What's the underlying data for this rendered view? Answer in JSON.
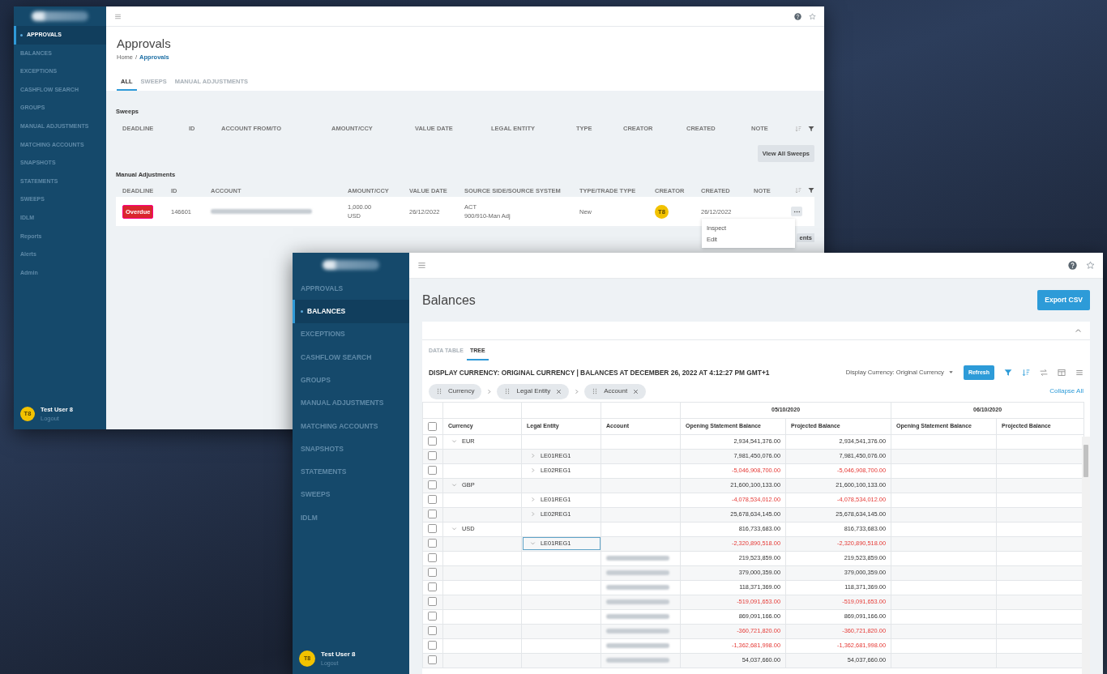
{
  "approvals_window": {
    "sidebar": {
      "items": [
        {
          "label": "APPROVALS",
          "selected": true
        },
        {
          "label": "BALANCES",
          "selected": false
        },
        {
          "label": "EXCEPTIONS",
          "selected": false
        },
        {
          "label": "CASHFLOW SEARCH",
          "selected": false
        },
        {
          "label": "GROUPS",
          "selected": false
        },
        {
          "label": "MANUAL ADJUSTMENTS",
          "selected": false
        },
        {
          "label": "MATCHING ACCOUNTS",
          "selected": false
        },
        {
          "label": "SNAPSHOTS",
          "selected": false
        },
        {
          "label": "STATEMENTS",
          "selected": false
        },
        {
          "label": "SWEEPS",
          "selected": false
        },
        {
          "label": "IDLM",
          "selected": false
        },
        {
          "label": "Reports",
          "selected": false
        },
        {
          "label": "Alerts",
          "selected": false
        },
        {
          "label": "Admin",
          "selected": false
        }
      ],
      "user": {
        "initials": "T8",
        "name": "Test User 8",
        "action": "Logout"
      }
    },
    "title": "Approvals",
    "breadcrumb": {
      "items": [
        "Home",
        "Approvals"
      ],
      "separator": "/"
    },
    "tabs": [
      {
        "label": "ALL",
        "selected": true
      },
      {
        "label": "SWEEPS",
        "selected": false
      },
      {
        "label": "MANUAL ADJUSTMENTS",
        "selected": false
      }
    ],
    "sweeps": {
      "title": "Sweeps",
      "columns": [
        "DEADLINE",
        "ID",
        "ACCOUNT FROM/TO",
        "AMOUNT/CCY",
        "VALUE DATE",
        "LEGAL ENTITY",
        "TYPE",
        "CREATOR",
        "CREATED",
        "NOTE"
      ],
      "button": "View All Sweeps"
    },
    "manual_adjustments": {
      "title": "Manual Adjustments",
      "columns": [
        "DEADLINE",
        "ID",
        "ACCOUNT",
        "AMOUNT/CCY",
        "VALUE DATE",
        "SOURCE SIDE/SOURCE SYSTEM",
        "TYPE/TRADE TYPE",
        "CREATOR",
        "CREATED",
        "NOTE"
      ],
      "rows": [
        {
          "deadline": "Overdue",
          "id": "146601",
          "amount": "1,000.00",
          "currency": "USD",
          "value_date": "26/12/2022",
          "source_side": "ACT",
          "source_system": "900/910-Man Adj",
          "type": "New",
          "creator": "T8",
          "created": "26/12/2022"
        }
      ],
      "action_menu": [
        "Inspect",
        "Edit"
      ],
      "button": "ents"
    }
  },
  "balances_window": {
    "sidebar": {
      "items": [
        {
          "label": "APPROVALS",
          "selected": false
        },
        {
          "label": "BALANCES",
          "selected": true
        },
        {
          "label": "EXCEPTIONS",
          "selected": false
        },
        {
          "label": "CASHFLOW SEARCH",
          "selected": false
        },
        {
          "label": "GROUPS",
          "selected": false
        },
        {
          "label": "MANUAL ADJUSTMENTS",
          "selected": false
        },
        {
          "label": "MATCHING ACCOUNTS",
          "selected": false
        },
        {
          "label": "SNAPSHOTS",
          "selected": false
        },
        {
          "label": "STATEMENTS",
          "selected": false
        },
        {
          "label": "SWEEPS",
          "selected": false
        },
        {
          "label": "IDLM",
          "selected": false
        }
      ],
      "user": {
        "initials": "T8",
        "name": "Test User 8",
        "action": "Logout"
      }
    },
    "title": "Balances",
    "export_button": "Export CSV",
    "tabs": [
      {
        "label": "DATA TABLE",
        "selected": false
      },
      {
        "label": "TREE",
        "selected": true
      }
    ],
    "heading": "DISPLAY CURRENCY: ORIGINAL CURRENCY | BALANCES AT DECEMBER 26, 2022 AT 4:12:27 PM GMT+1",
    "currency_select": "Display Currency: Original Currency",
    "refresh_button": "Refresh",
    "group_chips": [
      {
        "label": "Currency",
        "removable": false
      },
      {
        "label": "Legal Entity",
        "removable": true
      },
      {
        "label": "Account",
        "removable": true
      }
    ],
    "collapse_all": "Collapse All",
    "grid": {
      "date_groups": [
        "05/10/2020",
        "06/10/2020"
      ],
      "columns": [
        "Currency",
        "Legal Entity",
        "Account",
        "Opening Statement Balance",
        "Projected Balance",
        "Opening Statement Balance",
        "Projected Balance"
      ],
      "header_checked": false,
      "rows": [
        {
          "label": "EUR",
          "expanded": true,
          "checked": false,
          "focused": false,
          "opening": "2,934,541,376.00",
          "projected": "2,934,541,376.00",
          "negative": false,
          "children": [
            {
              "label": "LE01REG1",
              "expanded": false,
              "checked": false,
              "focused": false,
              "opening": "7,981,450,076.00",
              "projected": "7,981,450,076.00",
              "negative": false
            },
            {
              "label": "LE02REG1",
              "expanded": false,
              "checked": false,
              "focused": false,
              "opening": "-5,046,908,700.00",
              "projected": "-5,046,908,700.00",
              "negative": true
            }
          ]
        },
        {
          "label": "GBP",
          "expanded": true,
          "checked": false,
          "focused": false,
          "opening": "21,600,100,133.00",
          "projected": "21,600,100,133.00",
          "negative": false,
          "children": [
            {
              "label": "LE01REG1",
              "expanded": false,
              "checked": false,
              "focused": false,
              "opening": "-4,078,534,012.00",
              "projected": "-4,078,534,012.00",
              "negative": true
            },
            {
              "label": "LE02REG1",
              "expanded": false,
              "checked": false,
              "focused": false,
              "opening": "25,678,634,145.00",
              "projected": "25,678,634,145.00",
              "negative": false
            }
          ]
        },
        {
          "label": "USD",
          "expanded": true,
          "checked": false,
          "focused": false,
          "opening": "816,733,683.00",
          "projected": "816,733,683.00",
          "negative": false,
          "children": [
            {
              "label": "LE01REG1",
              "expanded": true,
              "checked": false,
              "focused": true,
              "opening": "-2,320,890,518.00",
              "projected": "-2,320,890,518.00",
              "negative": true,
              "children": [
                {
                  "checked": false,
                  "focused": false,
                  "opening": "219,523,859.00",
                  "projected": "219,523,859.00",
                  "negative": false
                },
                {
                  "checked": false,
                  "focused": false,
                  "opening": "379,000,359.00",
                  "projected": "379,000,359.00",
                  "negative": false
                },
                {
                  "checked": false,
                  "focused": false,
                  "opening": "118,371,369.00",
                  "projected": "118,371,369.00",
                  "negative": false
                },
                {
                  "checked": false,
                  "focused": false,
                  "opening": "-519,091,653.00",
                  "projected": "-519,091,653.00",
                  "negative": true
                },
                {
                  "checked": false,
                  "focused": false,
                  "opening": "869,091,166.00",
                  "projected": "869,091,166.00",
                  "negative": false
                },
                {
                  "checked": false,
                  "focused": false,
                  "opening": "-360,721,820.00",
                  "projected": "-360,721,820.00",
                  "negative": true
                },
                {
                  "checked": false,
                  "focused": false,
                  "opening": "-1,362,681,998.00",
                  "projected": "-1,362,681,998.00",
                  "negative": true
                },
                {
                  "checked": false,
                  "focused": false,
                  "opening": "54,037,660.00",
                  "projected": "54,037,660.00",
                  "negative": false
                }
              ]
            }
          ]
        }
      ]
    }
  }
}
